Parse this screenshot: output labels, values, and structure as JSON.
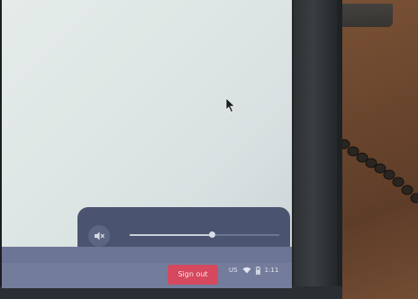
{
  "volume_bubble": {
    "mute_icon": "speaker-muted-icon",
    "level": 0.55
  },
  "shelf": {
    "signout_label": "Sign out",
    "input_method": "US",
    "wifi_icon": "wifi-icon",
    "battery_icon": "battery-icon",
    "time": "1:11"
  },
  "colors": {
    "bubble_bg": "#4a5470",
    "signout_bg": "#d6485e",
    "shelf_bg": "#6d7596"
  }
}
